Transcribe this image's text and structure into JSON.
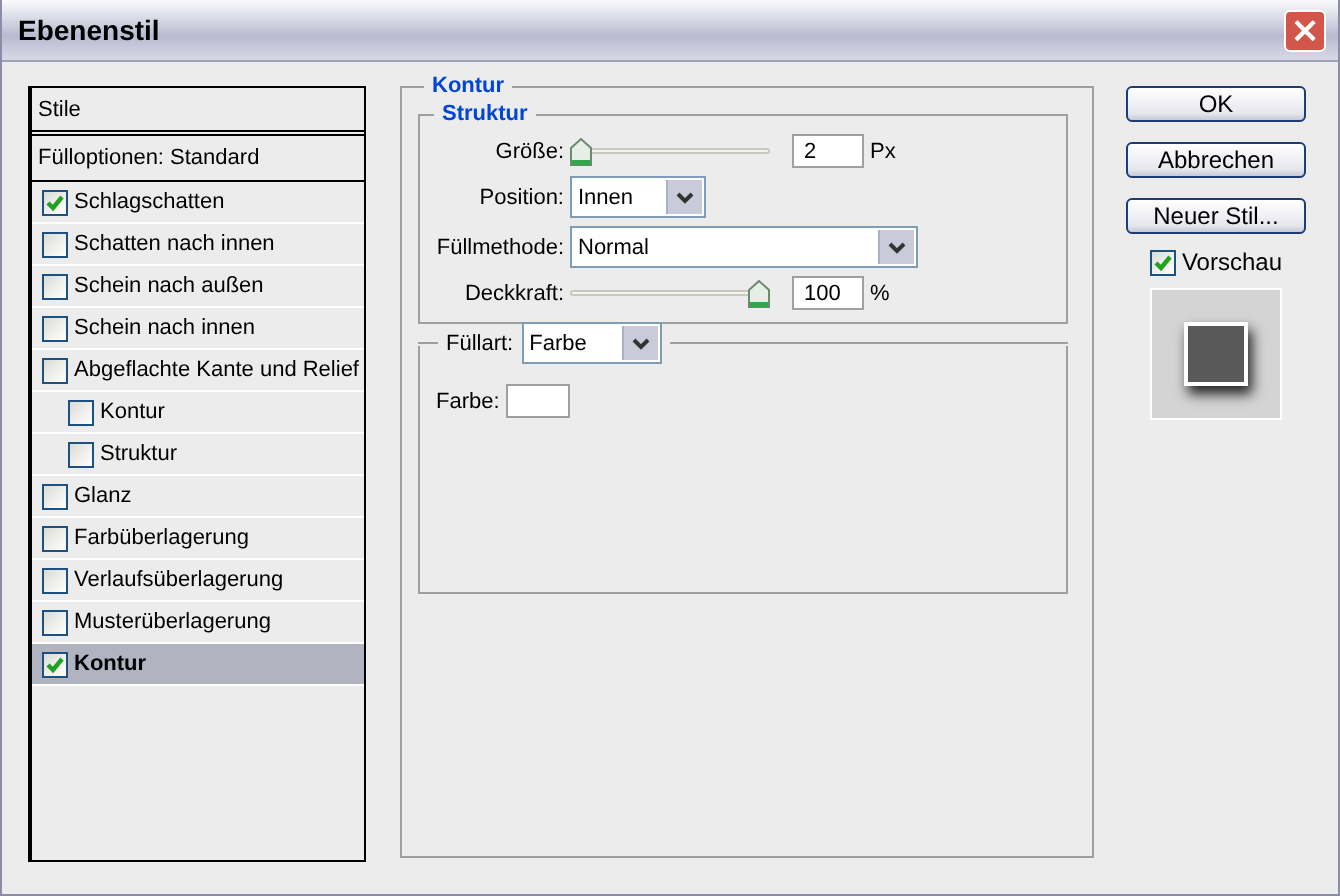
{
  "window": {
    "title": "Ebenenstil",
    "close_label": "×"
  },
  "styles_list": {
    "header": "Stile",
    "blending_options": "Fülloptionen: Standard",
    "items": [
      {
        "label": "Schlagschatten",
        "checked": true,
        "selected": false
      },
      {
        "label": "Schatten nach innen",
        "checked": false,
        "selected": false
      },
      {
        "label": "Schein nach außen",
        "checked": false,
        "selected": false
      },
      {
        "label": "Schein nach innen",
        "checked": false,
        "selected": false
      },
      {
        "label": "Abgeflachte Kante und Relief",
        "checked": false,
        "selected": false,
        "children": [
          {
            "label": "Kontur",
            "checked": false,
            "selected": false
          },
          {
            "label": "Struktur",
            "checked": false,
            "selected": false
          }
        ]
      },
      {
        "label": "Glanz",
        "checked": false,
        "selected": false
      },
      {
        "label": "Farbüberlagerung",
        "checked": false,
        "selected": false
      },
      {
        "label": "Verlaufsüberlagerung",
        "checked": false,
        "selected": false
      },
      {
        "label": "Musterüberlagerung",
        "checked": false,
        "selected": false
      },
      {
        "label": "Kontur",
        "checked": true,
        "selected": true
      }
    ]
  },
  "settings": {
    "title": "Kontur",
    "structure": {
      "title": "Struktur",
      "rows": [
        {
          "kind": "slider",
          "label": "Größe:",
          "level": 0,
          "value": "2",
          "unit": "Px"
        },
        {
          "kind": "select",
          "label": "Position:",
          "value": "Innen",
          "wide": false
        },
        {
          "kind": "select",
          "label": "Füllmethode:",
          "value": "Normal",
          "wide": true
        },
        {
          "kind": "slider",
          "label": "Deckkraft:",
          "level": 1,
          "value": "100",
          "unit": "%"
        }
      ]
    },
    "fill": {
      "label": "Füllart:",
      "value": "Farbe",
      "color_label": "Farbe:"
    }
  },
  "buttons": [
    "OK",
    "Abbrechen",
    "Neuer Stil..."
  ],
  "preview": {
    "label": "Vorschau",
    "checked": true
  }
}
